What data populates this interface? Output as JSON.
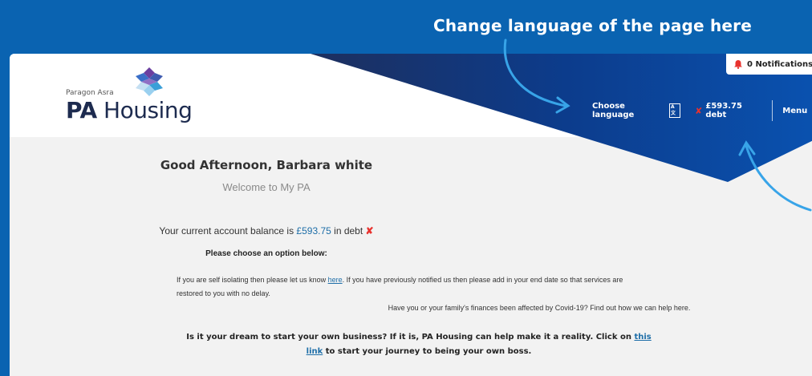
{
  "annotation": {
    "top": "Change language of the page here"
  },
  "logo": {
    "small": "Paragon Asra",
    "main_bold": "PA",
    "main_rest": " Housing"
  },
  "notifications": {
    "label": "0 Notifications"
  },
  "nav": {
    "choose_language": "Choose language",
    "debt": "£593.75 debt",
    "menu": "Menu"
  },
  "content": {
    "greeting": "Good Afternoon, Barbara white",
    "welcome": "Welcome to My PA",
    "balance_prefix": "Your current account balance is ",
    "balance_amount": "£593.75",
    "balance_suffix": " in debt ",
    "choose_option": "Please choose an option below:",
    "isolate_prefix": "If you are self isolating then please let us know ",
    "isolate_link": "here",
    "isolate_suffix": ".  If you have previously notified us then please add in your end date so that services are restored to you with no delay.",
    "covid": "Have you or your family's finances been affected by Covid-19?  Find out how we can help here.",
    "boss_prefix": "Is it your dream to start your own business? If it is, PA Housing can help make it a reality. Click on ",
    "boss_link": "this link",
    "boss_suffix": " to start your journey to being your own boss."
  },
  "colors": {
    "background": "#0a63b1",
    "banner": "#0d3f8f",
    "accent_red": "#e8322e",
    "link_blue": "#1e6ea8"
  }
}
